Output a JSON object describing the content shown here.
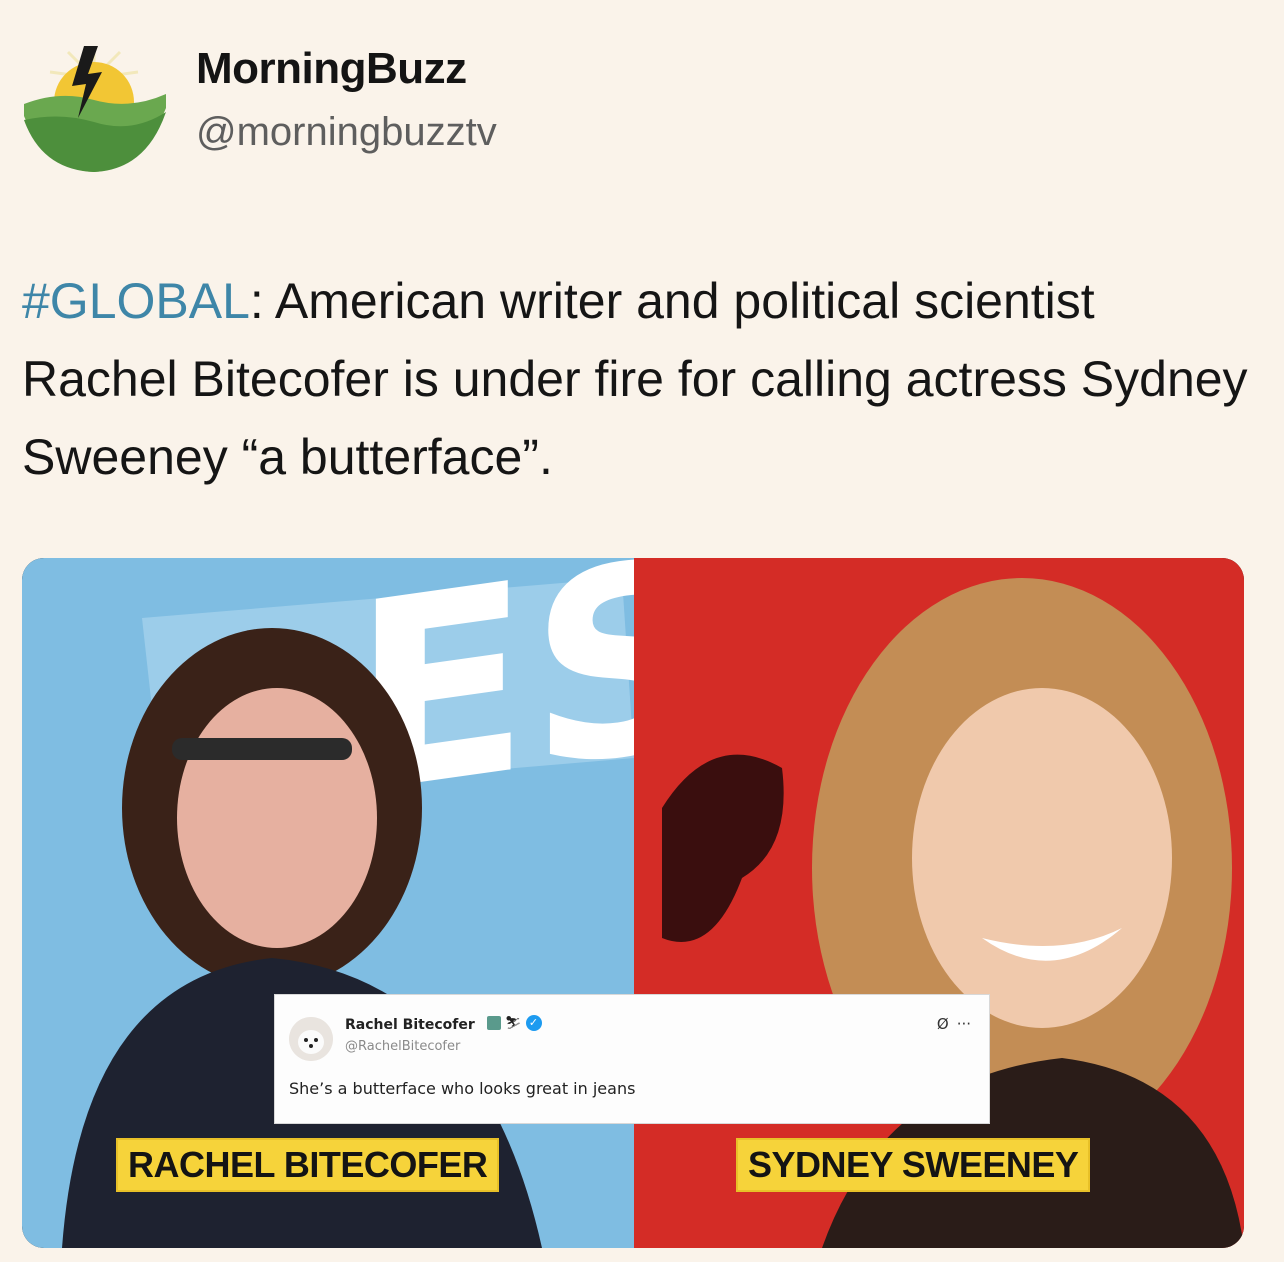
{
  "account": {
    "display_name": "MorningBuzz",
    "handle": "@morningbuzztv",
    "avatar_icon": "morningbuzz-logo-icon"
  },
  "post": {
    "hashtag": "#GLOBAL",
    "text": ": American writer and political scientist Rachel Bitecofer is under fire for calling actress Sydney Sweeney “a butterface”."
  },
  "media": {
    "left_caption": "RACHEL BITECOFER",
    "right_caption": "SYDNEY SWEENEY",
    "embedded_tweet": {
      "name": "Rachel Bitecofer",
      "handle": "@RachelBitecofer",
      "text": "She’s a butterface who looks great in jeans",
      "more_label": "···"
    }
  },
  "colors": {
    "background": "#faf3ea",
    "hashtag": "#3e86a8",
    "caption_bg": "#f6d33a",
    "left_photo_bg": "#7fbde2",
    "right_photo_bg": "#d42c26"
  }
}
